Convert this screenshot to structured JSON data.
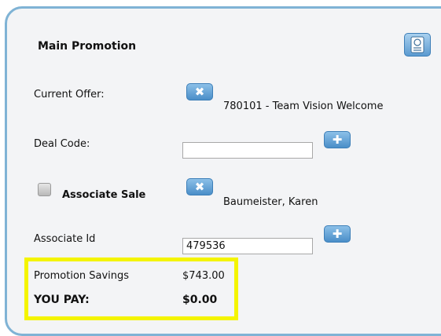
{
  "panel": {
    "title": "Main Promotion"
  },
  "current_offer": {
    "label": "Current Offer:",
    "value": "780101 - Team Vision Welcome",
    "remove_icon": "x-icon"
  },
  "deal_code": {
    "label": "Deal Code:",
    "value": "",
    "add_icon": "plus-icon"
  },
  "associate_sale": {
    "label": "Associate Sale",
    "checked": false,
    "value": "Baumeister, Karen",
    "remove_icon": "x-icon"
  },
  "associate_id": {
    "label": "Associate Id",
    "value": "479536",
    "add_icon": "plus-icon"
  },
  "summary": {
    "savings_label": "Promotion Savings",
    "savings_value": "$743.00",
    "pay_label": "YOU PAY:",
    "pay_value": "$0.00"
  },
  "colors": {
    "panel_border": "#7fb3d5",
    "button_blue": "#4a8ec8",
    "highlight": "#f4f400"
  }
}
